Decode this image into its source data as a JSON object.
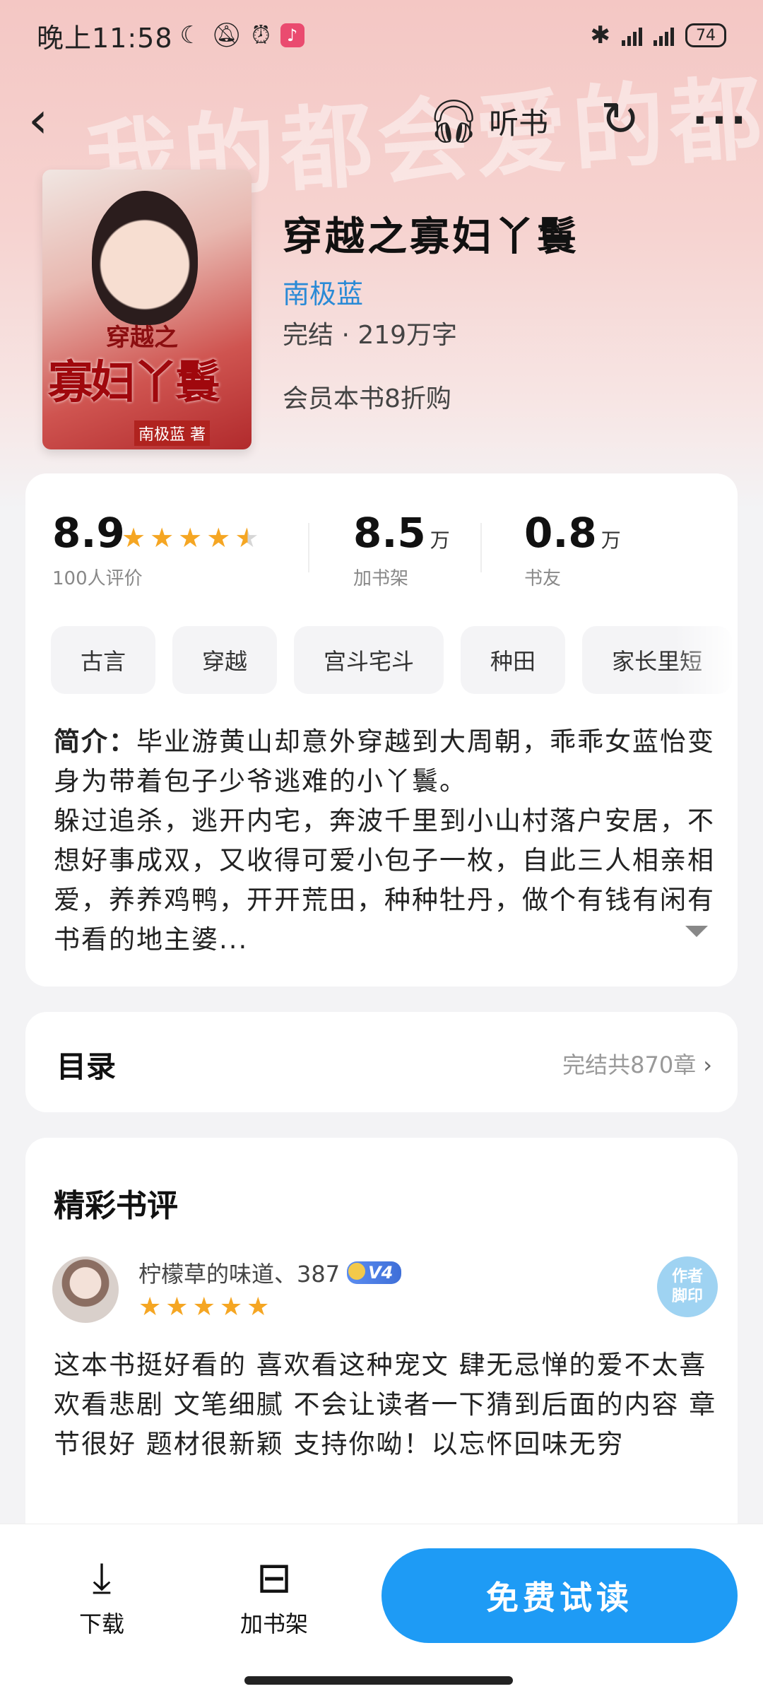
{
  "status_bar": {
    "time": "晚上11:58",
    "left_icons": [
      "moon-icon",
      "mute-icon",
      "alarm-icon",
      "tiktok-icon"
    ],
    "battery": "74"
  },
  "nav": {
    "back_icon": "back-icon",
    "listen_label": "听书",
    "share_icon": "share-icon",
    "more_icon": "more-icon"
  },
  "hero": {
    "watermark": "我的都会爱的都市"
  },
  "book": {
    "cover_title_small": "穿越之",
    "cover_title_big": "寡妇丫鬟",
    "cover_author": "南极蓝 著",
    "title": "穿越之寡妇丫鬟",
    "author": "南极蓝",
    "meta": "完结 · 219万字",
    "vip": "会员本书8折购"
  },
  "stats": {
    "rating": "8.9",
    "rating_stars": 4.5,
    "rating_label": "100人评价",
    "shelf": "8.5",
    "shelf_unit": "万",
    "shelf_label": "加书架",
    "friends": "0.8",
    "friends_unit": "万",
    "friends_label": "书友"
  },
  "tags": [
    "古言",
    "穿越",
    "宫斗宅斗",
    "种田",
    "家长里短"
  ],
  "intro": {
    "label": "简介：",
    "text1": "毕业游黄山却意外穿越到大周朝，乖乖女蓝怡变身为带着包子少爷逃难的小丫鬟。",
    "text2": "躲过追杀，逃开内宅，奔波千里到小山村落户安居，不想好事成双，又收得可爱小包子一枚，自此三人相亲相爱，养养鸡鸭，开开荒田，种种牡丹，做个有钱有闲有书看的地主婆..."
  },
  "toc": {
    "title": "目录",
    "summary": "完结共870章",
    "chevron": "›"
  },
  "reviews": {
    "title": "精彩书评",
    "items": [
      {
        "name": "柠檬草的味道、387",
        "badge": "V4",
        "stars": 5,
        "seal_line1": "作者",
        "seal_line2": "脚印",
        "text": "这本书挺好看的 喜欢看这种宠文 肆无忌惮的爱不太喜欢看悲剧 文笔细腻 不会让读者一下猜到后面的内容 章节很好 题材很新颖 支持你呦！以忘怀回味无穷"
      }
    ]
  },
  "bottom": {
    "download_label": "下载",
    "shelf_label": "加书架",
    "read_label": "免费试读"
  },
  "colors": {
    "accent": "#1e9bf5",
    "author_link": "#2a8ad6",
    "star": "#f5a623"
  }
}
